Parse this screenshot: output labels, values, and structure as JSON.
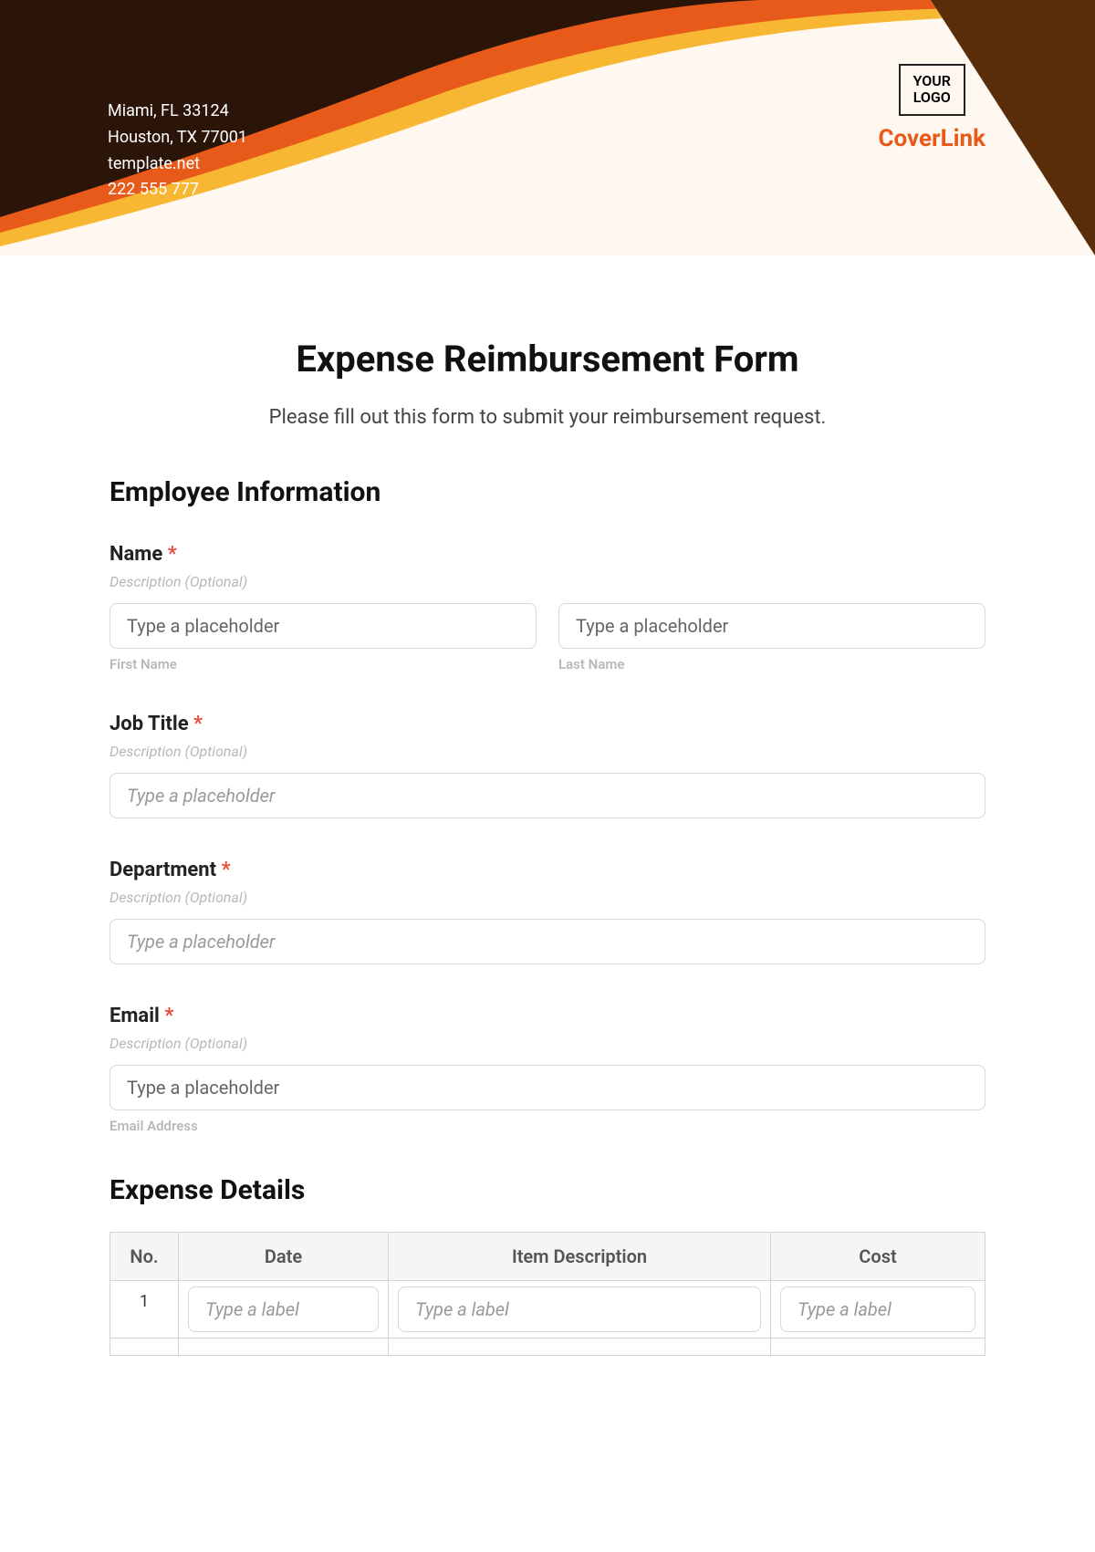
{
  "header": {
    "address_line1": "Miami, FL 33124",
    "address_line2": "Houston, TX 77001",
    "website": "template.net",
    "phone": "222 555 777",
    "logo_line1": "YOUR",
    "logo_line2": "LOGO",
    "brand": "CoverLink"
  },
  "form": {
    "title": "Expense Reimbursement Form",
    "subtitle": "Please fill out this form to submit your reimbursement request.",
    "section_employee": "Employee Information",
    "name": {
      "label": "Name",
      "desc": "Description (Optional)",
      "first_placeholder": "Type a placeholder",
      "last_placeholder": "Type a placeholder",
      "first_sub": "First Name",
      "last_sub": "Last Name"
    },
    "job": {
      "label": "Job Title",
      "desc": "Description (Optional)",
      "placeholder": "Type a placeholder"
    },
    "dept": {
      "label": "Department",
      "desc": "Description (Optional)",
      "placeholder": "Type a placeholder"
    },
    "email": {
      "label": "Email",
      "desc": "Description (Optional)",
      "placeholder": "Type a placeholder",
      "sub": "Email Address"
    },
    "section_details": "Expense Details",
    "table": {
      "col_no": "No.",
      "col_date": "Date",
      "col_item": "Item Description",
      "col_cost": "Cost",
      "row1_no": "1",
      "cell_placeholder": "Type a label"
    }
  },
  "required_marker": "*"
}
